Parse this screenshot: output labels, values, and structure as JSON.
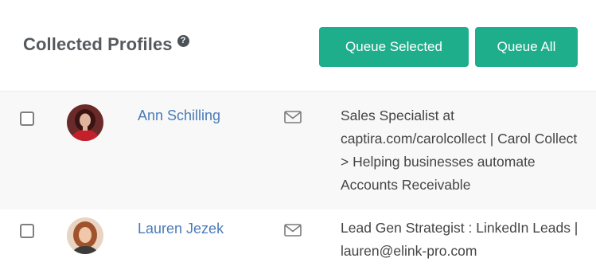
{
  "header": {
    "title": "Collected Profiles",
    "help_icon": "question-circle-icon",
    "queue_selected_label": "Queue Selected",
    "queue_all_label": "Queue All",
    "accent_color": "#1fae8b"
  },
  "profiles": [
    {
      "name": "Ann Schilling",
      "headline": "Sales Specialist at captira.com/carolcollect | Carol Collect > Helping businesses automate Accounts Receivable",
      "checked": false,
      "message_icon": "envelope-icon"
    },
    {
      "name": "Lauren Jezek",
      "headline": "Lead Gen Strategist : LinkedIn Leads | lauren@elink-pro.com",
      "checked": false,
      "message_icon": "envelope-icon"
    }
  ]
}
